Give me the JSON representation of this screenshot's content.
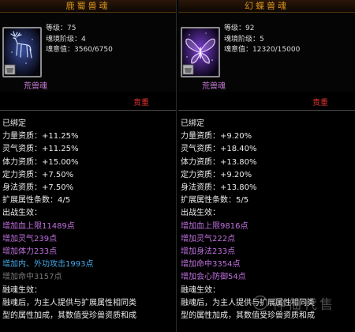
{
  "left": {
    "title": "鹿蜀兽魂",
    "level": "等级：75",
    "realm": "魂境阶级：4",
    "soul": "魂意值：3560/6750",
    "name": "荒兽魂",
    "quality": "贵重",
    "icon": "deer-spirit-icon",
    "lines": [
      {
        "text": "已绑定",
        "color": "white"
      },
      {
        "text": "力量资质：+11.25%",
        "color": "white"
      },
      {
        "text": "灵气资质：+11.25%",
        "color": "white"
      },
      {
        "text": "体力资质：+15.00%",
        "color": "white"
      },
      {
        "text": "定力资质：+7.50%",
        "color": "white"
      },
      {
        "text": "身法资质：+7.50%",
        "color": "white"
      },
      {
        "text": "扩展属性条数：4/5",
        "color": "white"
      },
      {
        "text": "出战生效：",
        "color": "white"
      },
      {
        "text": "增加血上限11489点",
        "color": "purple"
      },
      {
        "text": "增加灵气239点",
        "color": "purple"
      },
      {
        "text": "增加体力233点",
        "color": "purple"
      },
      {
        "text": "增加内、外功攻击1993点",
        "color": "blue"
      },
      {
        "text": "增加命中3157点",
        "color": "gray"
      },
      {
        "text": "融魂生效：",
        "color": "white"
      },
      {
        "text": "融魂后，为主人提供与扩展属性相同类",
        "color": "white"
      },
      {
        "text": "型的属性加成，其数值受珍兽资质和成",
        "color": "white"
      }
    ]
  },
  "right": {
    "title": "幻蝶兽魂",
    "level": "等级：92",
    "realm": "魂境阶级：5",
    "soul": "魂意值：12320/15000",
    "name": "荒兽魂",
    "quality": "贵重",
    "icon": "butterfly-spirit-icon",
    "lines": [
      {
        "text": "已绑定",
        "color": "white"
      },
      {
        "text": "力量资质：+9.20%",
        "color": "white"
      },
      {
        "text": "灵气资质：+18.40%",
        "color": "white"
      },
      {
        "text": "体力资质：+13.80%",
        "color": "white"
      },
      {
        "text": "定力资质：+9.20%",
        "color": "white"
      },
      {
        "text": "身法资质：+13.80%",
        "color": "white"
      },
      {
        "text": "扩展属性条数：5/5",
        "color": "white"
      },
      {
        "text": "出战生效：",
        "color": "white"
      },
      {
        "text": "增加血上限9816点",
        "color": "purple"
      },
      {
        "text": "增加灵气222点",
        "color": "purple"
      },
      {
        "text": "增加身法233点",
        "color": "purple"
      },
      {
        "text": "增加命中3354点",
        "color": "purple"
      },
      {
        "text": "增加会心防御54点",
        "color": "purple"
      },
      {
        "text": "融魂生效：",
        "color": "white"
      },
      {
        "text": "融魂后，为主人提供与扩展属性相同类",
        "color": "white"
      },
      {
        "text": "型的属性加成，其数值受珍兽资质和成",
        "color": "white"
      }
    ]
  },
  "watermark": {
    "text": "神仙代售",
    "icon": "watermark-logo-icon"
  }
}
